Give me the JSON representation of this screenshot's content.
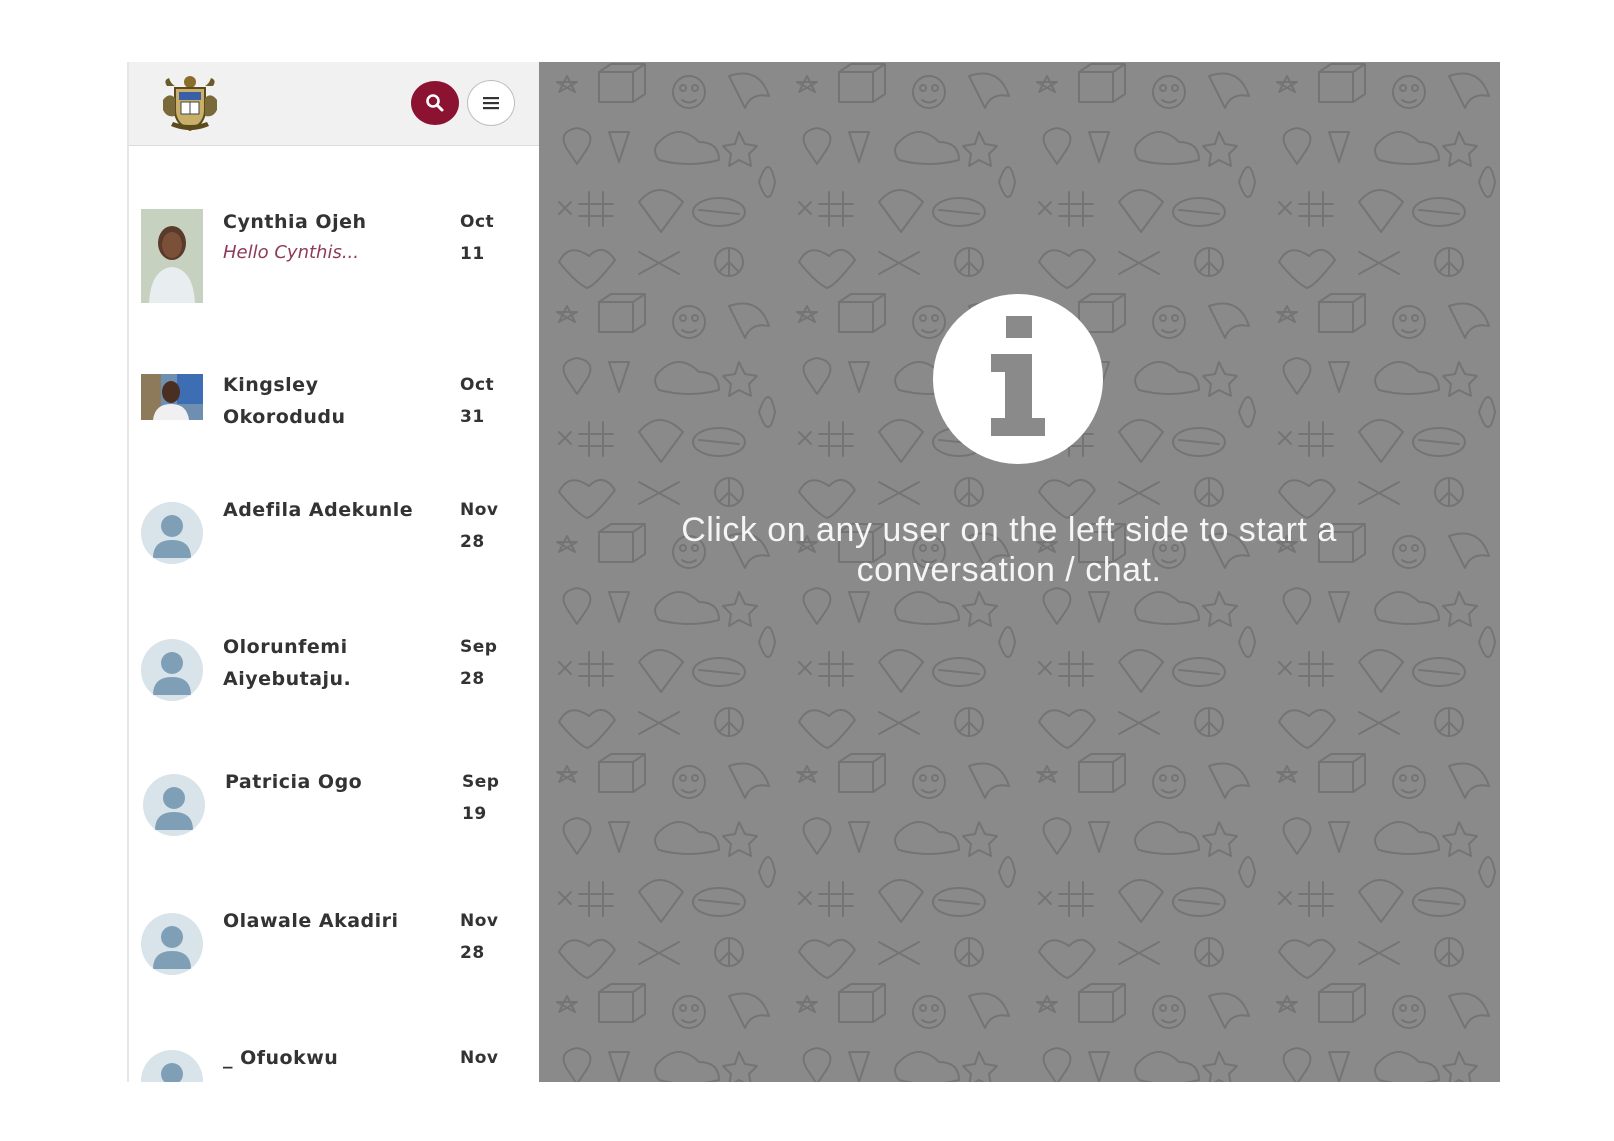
{
  "header": {
    "logo_icon": "school-crest-logo",
    "search_icon": "search-icon",
    "menu_icon": "hamburger-menu-icon",
    "search_color": "#8b1230"
  },
  "contacts": [
    {
      "name": "Cynthia Ojeh",
      "preview": "Hello Cynthis...",
      "month": "Oct",
      "day": "11",
      "avatar": "photo"
    },
    {
      "name": "Kingsley Okorodudu",
      "name_line1": "Kingsley",
      "name_line2": "Okorodudu",
      "month": "Oct",
      "day": "31",
      "avatar": "photo"
    },
    {
      "name": "Adefila Adekunle",
      "month": "Nov",
      "day": "28",
      "avatar": "default"
    },
    {
      "name": "Olorunfemi Aiyebutaju.",
      "name_line1": "Olorunfemi",
      "name_line2": "Aiyebutaju.",
      "month": "Sep",
      "day": "28",
      "avatar": "default"
    },
    {
      "name": "Patricia Ogo",
      "month": "Sep",
      "day": "19",
      "avatar": "default"
    },
    {
      "name": "Olawale Akadiri",
      "month": "Nov",
      "day": "28",
      "avatar": "default"
    },
    {
      "name": "_ Ofuokwu",
      "month": "Nov",
      "avatar": "default"
    }
  ],
  "main": {
    "info_icon": "info-icon",
    "message_line1": "Click on any user on the left side to start a",
    "message_line2": "conversation / chat.",
    "background_color": "#8a8a8a"
  }
}
